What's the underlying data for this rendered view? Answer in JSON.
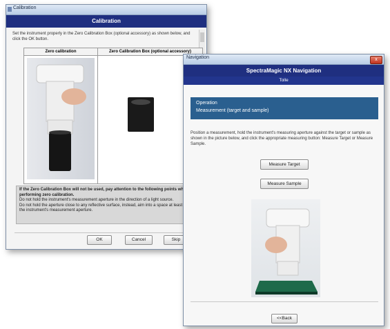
{
  "calibration_window": {
    "title": "Calibration",
    "close_glyph": "x",
    "header": "Calibration",
    "instruction": "Set the instrument properly in the Zero Calibration Box (optional accessory) as shown below, and click the OK button.",
    "columns": [
      "Zero calibration",
      "Zero Calibration Box (optional accessory)"
    ],
    "warning_title": "If the Zero Calibration Box will not be used, pay attention to the following points when performing zero calibration.",
    "warning_lines": [
      "Do not hold the instrument's measurement aperture in the direction of a light source.",
      "Do not hold the aperture close to any reflective surface, instead, aim into a space at least 1m from the instrument's measurement aperture."
    ],
    "buttons": {
      "ok": "OK",
      "cancel": "Cancel",
      "skip": "Skip"
    }
  },
  "navigation_window": {
    "title": "Navigation",
    "close_glyph": "x",
    "header": "SpectraMagic NX Navigation",
    "subheader": "Tolle",
    "operation_title": "Operation",
    "operation_subtitle": "Measurement (target and sample)",
    "instruction": "Position a measurement, hold the instrument's measuring aperture against the target or sample as shown in the picture below, and click the appropriate measuring button: Measure Target or Measure Sample.",
    "buttons": {
      "measure_target": "Measure Target",
      "measure_sample": "Measure Sample",
      "back": "<<Back"
    }
  },
  "colors": {
    "header_blue": "#1f2f80",
    "operation_blue": "#2a5f8f"
  }
}
